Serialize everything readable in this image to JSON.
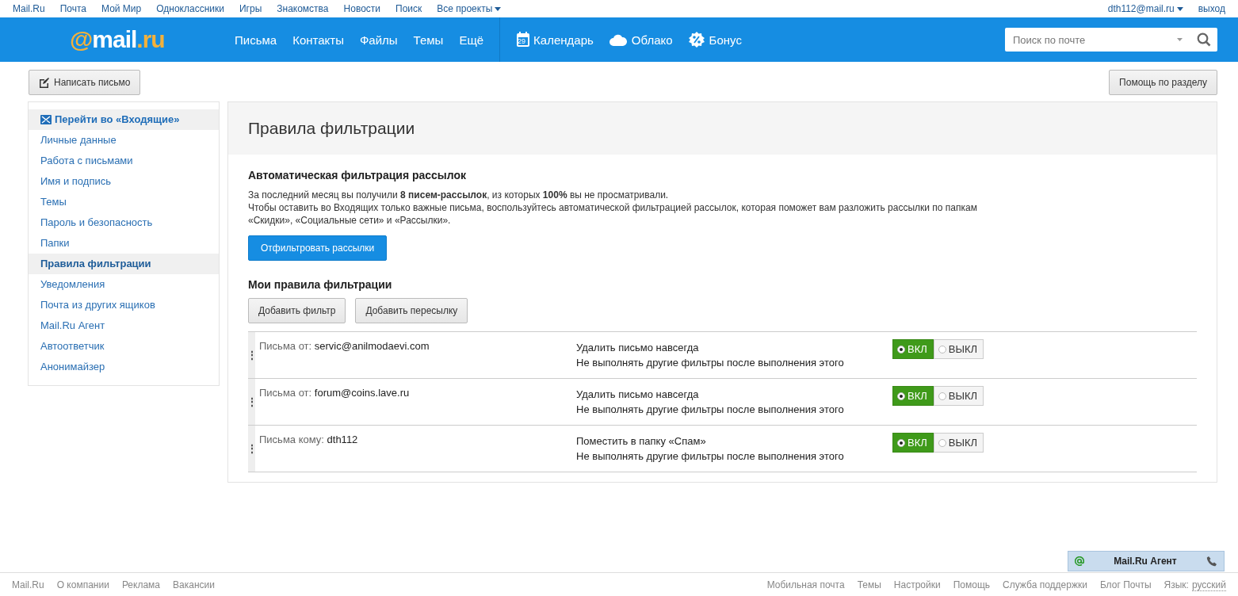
{
  "portal_bar": {
    "links": [
      "Mail.Ru",
      "Почта",
      "Мой Мир",
      "Одноклассники",
      "Игры",
      "Знакомства",
      "Новости",
      "Поиск"
    ],
    "all_projects": "Все проекты",
    "user": "dth112@mail.ru",
    "logout": "выход"
  },
  "header": {
    "logo": {
      "at": "@",
      "name": "mail",
      ".ru": ".ru"
    },
    "nav": [
      "Письма",
      "Контакты",
      "Файлы",
      "Темы",
      "Ещё"
    ],
    "services": [
      {
        "kind": "calendar",
        "label": "Календарь",
        "day": "29"
      },
      {
        "kind": "cloud",
        "label": "Облако"
      },
      {
        "kind": "bonus",
        "label": "Бонус"
      }
    ],
    "search": {
      "placeholder": "Поиск по почте"
    }
  },
  "toolbar": {
    "compose": "Написать письмо",
    "help": "Помощь по разделу"
  },
  "sidebar": {
    "inbox_link": "Перейти во «Входящие»",
    "items": [
      {
        "label": "Личные данные",
        "selected": false
      },
      {
        "label": "Работа с письмами",
        "selected": false
      },
      {
        "label": "Имя и подпись",
        "selected": false
      },
      {
        "label": "Темы",
        "selected": false
      },
      {
        "label": "Пароль и безопасность",
        "selected": false
      },
      {
        "label": "Папки",
        "selected": false
      },
      {
        "label": "Правила фильтрации",
        "selected": true
      },
      {
        "label": "Уведомления",
        "selected": false
      },
      {
        "label": "Почта из других ящиков",
        "selected": false
      },
      {
        "label": "Mail.Ru Агент",
        "selected": false
      },
      {
        "label": "Автоответчик",
        "selected": false
      },
      {
        "label": "Анонимайзер",
        "selected": false
      }
    ]
  },
  "main": {
    "title": "Правила фильтрации",
    "auto": {
      "heading": "Автоматическая фильтрация рассылок",
      "text": "За последний месяц вы получили **8 писем-рассылок**, из которых **100%** вы не просматривали.",
      "text2": "Чтобы оставить во Входящих только важные письма, воспользуйтесь автоматической фильтрацией рассылок, которая поможет вам разложить рассылки по папкам «Скидки», «Социальные сети» и «Рассылки».",
      "button": "Отфильтровать рассылки"
    },
    "rules_heading": "Мои правила фильтрации",
    "handle": "⋮",
    "add_filter": "Добавить фильтр",
    "add_forward": "Добавить пересылку",
    "rules": [
      {
        "condition": "Письма от:",
        "value": "servic@anilmodaevi.com",
        "action": "Удалить письмо навсегда",
        "note": "Не выполнять другие фильтры после выполнения этого",
        "on": true,
        "on_label": "ВКЛ",
        "off_label": "ВЫКЛ"
      },
      {
        "condition": "Письма от:",
        "value": "forum@coins.lave.ru",
        "action": "Удалить письмо навсегда",
        "note": "Не выполнять другие фильтры после выполнения этого",
        "on": true,
        "on_label": "ВКЛ",
        "off_label": "ВЫКЛ"
      },
      {
        "condition": "Письма кому:",
        "value": "dth112",
        "action": "Поместить в папку «Спам»",
        "note": "Не выполнять другие фильтры после выполнения этого",
        "on": true,
        "on_label": "ВКЛ",
        "off_label": "ВЫКЛ"
      }
    ]
  },
  "agent": {
    "label": "Mail.Ru Агент"
  },
  "footer": {
    "left": [
      "Mail.Ru",
      "О компании",
      "Реклама",
      "Вакансии"
    ],
    "right": [
      "Мобильная почта",
      "Темы",
      "Настройки",
      "Помощь",
      "Служба поддержки",
      "Блог Почты"
    ],
    "language_label": "Язык:",
    "language": "русский"
  }
}
